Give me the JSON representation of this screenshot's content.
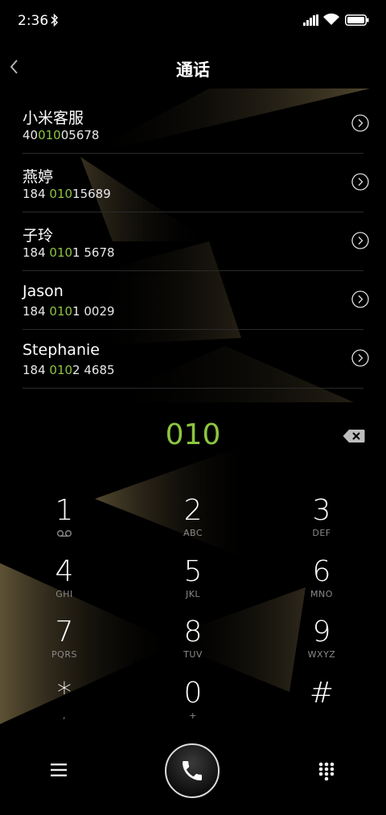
{
  "status_bar": {
    "time": "2:36",
    "icons": [
      "bluetooth-icon",
      "signal-icon",
      "wifi-icon",
      "battery-icon"
    ]
  },
  "header": {
    "title": "通话",
    "back_icon": "chevron-left-icon"
  },
  "contacts": [
    {
      "name": "小米客服",
      "number_pre": "40",
      "number_match": "010",
      "number_post": "05678"
    },
    {
      "name": "燕婷",
      "number_pre": "184 ",
      "number_match": "010",
      "number_post": "15689"
    },
    {
      "name": "子玲",
      "number_pre": "184 ",
      "number_match": "010",
      "number_post": "1 5678"
    },
    {
      "name": "Jason",
      "number_pre": "184 ",
      "number_match": "010",
      "number_post": "1 0029"
    },
    {
      "name": "Stephanie",
      "number_pre": "184 ",
      "number_match": "010",
      "number_post": "2 4685"
    }
  ],
  "dialed_number": "010",
  "keypad": [
    {
      "digit": "1",
      "letters": "",
      "sub_icon": "voicemail-icon"
    },
    {
      "digit": "2",
      "letters": "ABC"
    },
    {
      "digit": "3",
      "letters": "DEF"
    },
    {
      "digit": "4",
      "letters": "GHI"
    },
    {
      "digit": "5",
      "letters": "JKL"
    },
    {
      "digit": "6",
      "letters": "MNO"
    },
    {
      "digit": "7",
      "letters": "PQRS"
    },
    {
      "digit": "8",
      "letters": "TUV"
    },
    {
      "digit": "9",
      "letters": "WXYZ"
    },
    {
      "digit": "*",
      "letters": ","
    },
    {
      "digit": "0",
      "letters": "+"
    },
    {
      "digit": "#",
      "letters": ""
    }
  ],
  "bottom_bar": {
    "left_icon": "menu-icon",
    "center_icon": "phone-icon",
    "right_icon": "keypad-icon"
  },
  "colors": {
    "background": "#000000",
    "accent_green": "#8dc63f",
    "background_shape": "#6b5d3e"
  }
}
